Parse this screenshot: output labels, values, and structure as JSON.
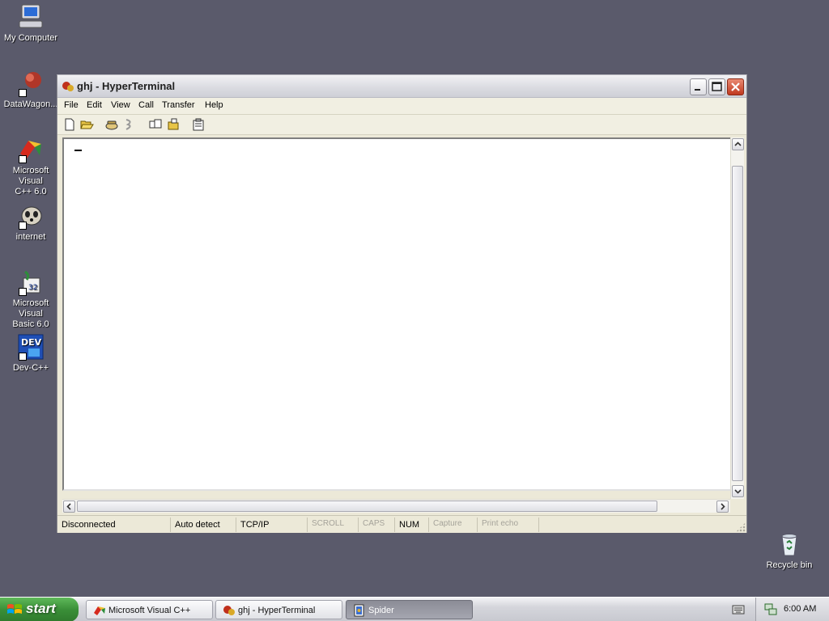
{
  "desktop": {
    "icons": [
      {
        "label": "My Computer",
        "icon": "my-computer-icon"
      },
      {
        "label": "DataWagon...",
        "icon": "datawagon-icon"
      },
      {
        "label": "Microsoft Visual\nC++ 6.0",
        "icon": "visual-cpp-icon"
      },
      {
        "label": "internet",
        "icon": "internet-icon"
      },
      {
        "label": "Microsoft Visual\nBasic 6.0",
        "icon": "visual-basic-icon"
      },
      {
        "label": "Dev-C++",
        "icon": "dev-cpp-icon"
      }
    ],
    "recycle_bin": {
      "label": "Recycle bin",
      "icon": "recycle-bin-icon"
    },
    "background_color": "#5a5a6b"
  },
  "window": {
    "title": "ghj - HyperTerminal",
    "menu": [
      "File",
      "Edit",
      "View",
      "Call",
      "Transfer",
      "Help"
    ],
    "toolbar": [
      "new-icon",
      "open-icon",
      "call-icon",
      "disconnect-icon",
      "send-icon",
      "receive-icon",
      "properties-icon"
    ],
    "status": {
      "connection": "Disconnected",
      "detect": "Auto detect",
      "protocol": "TCP/IP",
      "scroll": "SCROLL",
      "caps": "CAPS",
      "num": "NUM",
      "capture": "Capture",
      "print_echo": "Print echo"
    }
  },
  "taskbar": {
    "start_label": "start",
    "tasks": [
      {
        "label": "Microsoft Visual C++",
        "active": false
      },
      {
        "label": "ghj - HyperTerminal",
        "active": false
      },
      {
        "label": "Spider",
        "active": true
      }
    ],
    "clock": "6:00 AM"
  }
}
